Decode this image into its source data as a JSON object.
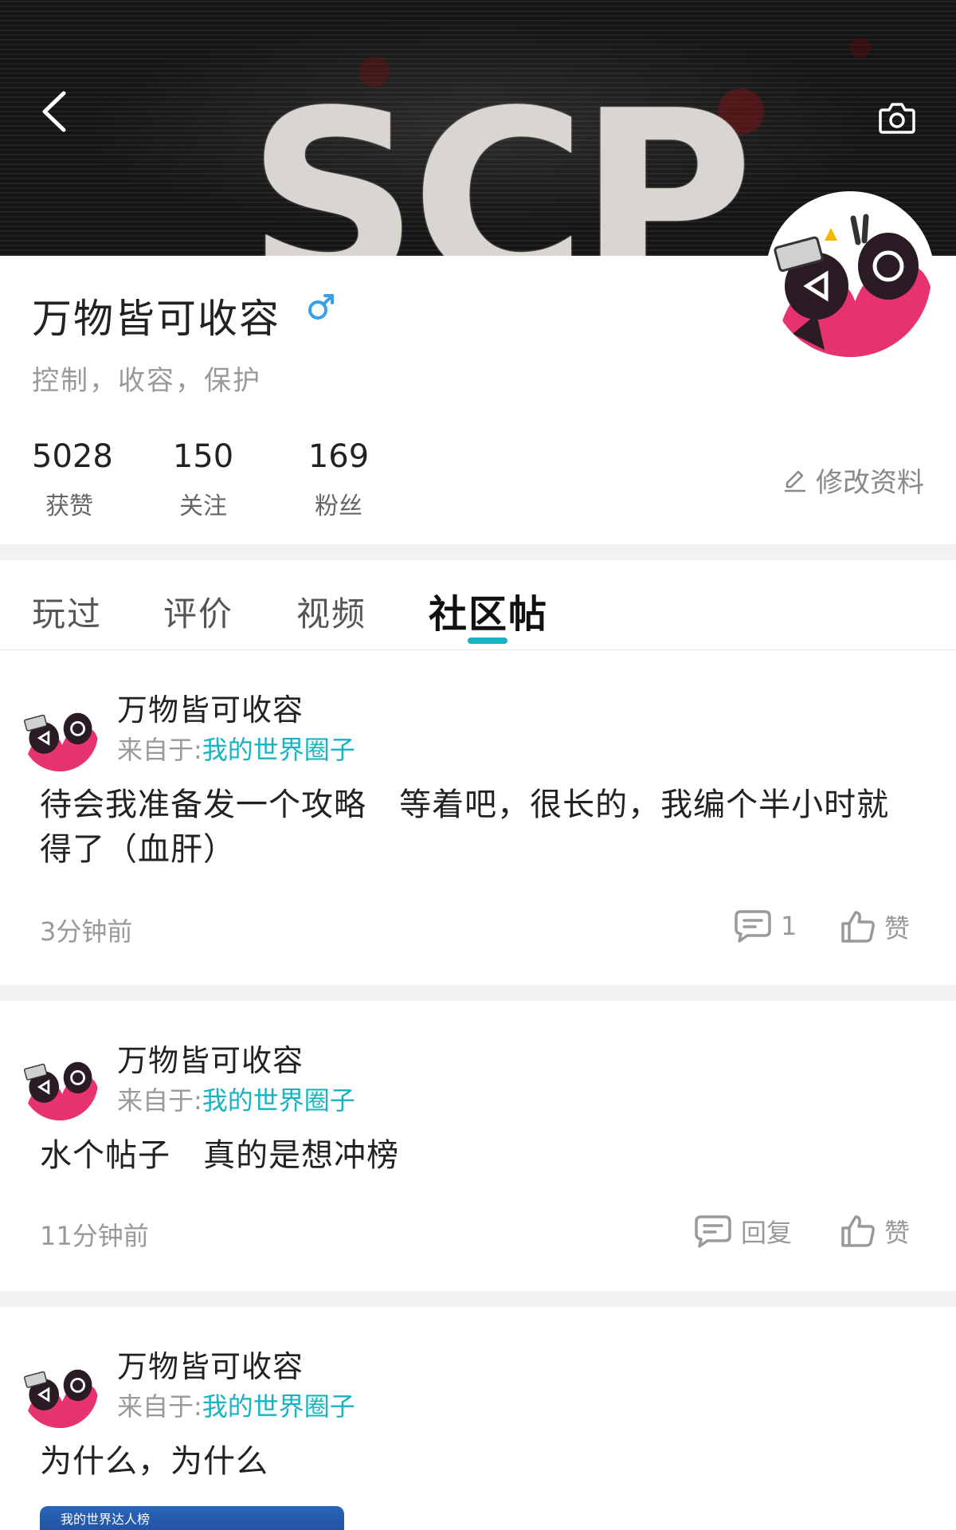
{
  "profile": {
    "name": "万物皆可收容",
    "gender_symbol": "♂",
    "bio": "控制，收容，保护",
    "banner_text": "SCP",
    "stats": [
      {
        "value": "5028",
        "label": "获赞"
      },
      {
        "value": "150",
        "label": "关注"
      },
      {
        "value": "169",
        "label": "粉丝"
      }
    ],
    "edit_label": "修改资料"
  },
  "tabs": [
    {
      "label": "玩过",
      "active": false
    },
    {
      "label": "评价",
      "active": false
    },
    {
      "label": "视频",
      "active": false
    },
    {
      "label": "社区帖",
      "active": true
    }
  ],
  "posts": [
    {
      "author": "万物皆可收容",
      "source_prefix": "来自于:",
      "source_link": "我的世界圈子",
      "body": "待会我准备发一个攻略   等着吧，很长的，我编个半小时就得了（血肝）",
      "time": "3分钟前",
      "comment_label": "1",
      "like_label": "赞"
    },
    {
      "author": "万物皆可收容",
      "source_prefix": "来自于:",
      "source_link": "我的世界圈子",
      "body": "水个帖子   真的是想冲榜",
      "time": "11分钟前",
      "comment_label": "回复",
      "like_label": "赞"
    },
    {
      "author": "万物皆可收容",
      "source_prefix": "来自于:",
      "source_link": "我的世界圈子",
      "body": "为什么，为什么",
      "attachment_caption": "我的世界达人榜"
    }
  ],
  "colors": {
    "accent": "#17b3c3",
    "gender": "#3aa0e6",
    "avatar_pink": "#e6336f"
  }
}
